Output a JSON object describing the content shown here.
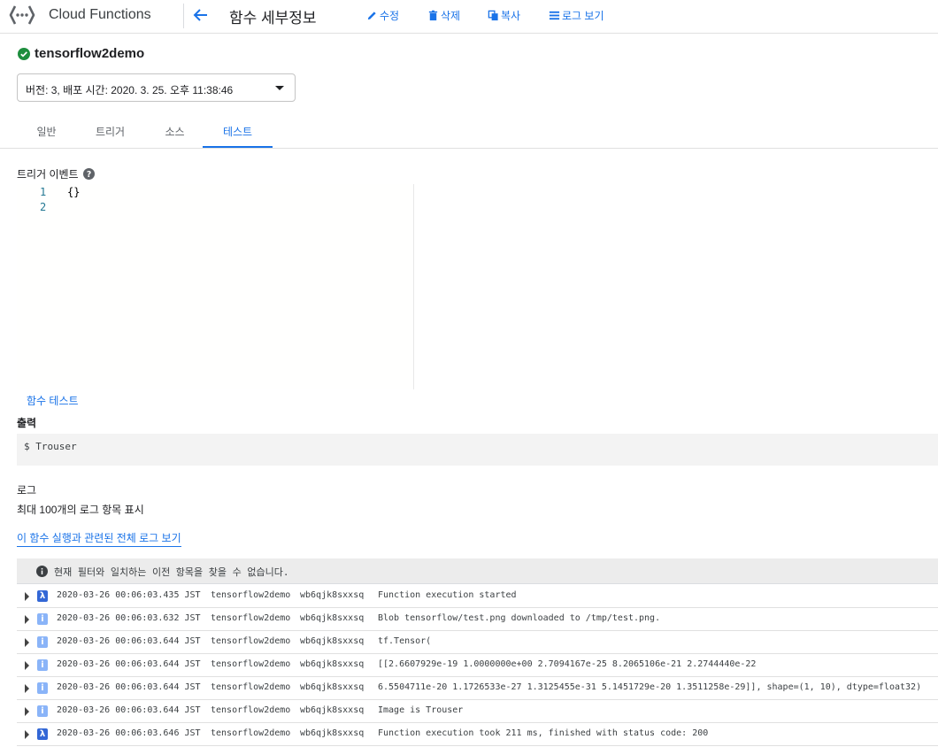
{
  "header": {
    "product_name": "Cloud Functions",
    "page_title": "함수 세부정보",
    "actions": {
      "edit": "수정",
      "delete": "삭제",
      "copy": "복사",
      "view_logs": "로그 보기"
    }
  },
  "function": {
    "name": "tensorflow2demo",
    "status_icon": "check-circle-icon",
    "status_color": "#1e8e3e",
    "version_select": "버전: 3, 배포 시간: 2020. 3. 25. 오후 11:38:46"
  },
  "tabs": [
    {
      "label": "일반",
      "active": false
    },
    {
      "label": "트리거",
      "active": false
    },
    {
      "label": "소스",
      "active": false
    },
    {
      "label": "테스트",
      "active": true
    }
  ],
  "trigger_event": {
    "label": "트리거 이벤트",
    "editor": {
      "line_numbers": [
        "1",
        "2"
      ],
      "lines": [
        "{}",
        ""
      ]
    }
  },
  "test_button": "함수 테스트",
  "output": {
    "label": "출력",
    "text": "$ Trouser"
  },
  "logs": {
    "label": "로그",
    "subtitle": "최대 100개의 로그 항목 표시",
    "view_all_link": "이 함수 실행과 관련된 전체 로그 보기",
    "notice": "현재 필터와 일치하는 이전 항목을 찾을 수 없습니다.",
    "entries": [
      {
        "severity": "debug",
        "icon": "λ",
        "time": "2020-03-26 00:06:03.435 JST",
        "function": "tensorflow2demo",
        "execution_id": "wb6qjk8sxxsq",
        "message": "Function execution started"
      },
      {
        "severity": "info",
        "icon": "i",
        "time": "2020-03-26 00:06:03.632 JST",
        "function": "tensorflow2demo",
        "execution_id": "wb6qjk8sxxsq",
        "message": "Blob tensorflow/test.png downloaded to /tmp/test.png."
      },
      {
        "severity": "info",
        "icon": "i",
        "time": "2020-03-26 00:06:03.644 JST",
        "function": "tensorflow2demo",
        "execution_id": "wb6qjk8sxxsq",
        "message": "tf.Tensor("
      },
      {
        "severity": "info",
        "icon": "i",
        "time": "2020-03-26 00:06:03.644 JST",
        "function": "tensorflow2demo",
        "execution_id": "wb6qjk8sxxsq",
        "message": "[[2.6607929e-19 1.0000000e+00 2.7094167e-25 8.2065106e-21 2.2744440e-22"
      },
      {
        "severity": "info",
        "icon": "i",
        "time": "2020-03-26 00:06:03.644 JST",
        "function": "tensorflow2demo",
        "execution_id": "wb6qjk8sxxsq",
        "message": "6.5504711e-20 1.1726533e-27 1.3125455e-31 5.1451729e-20 1.3511258e-29]], shape=(1, 10), dtype=float32)"
      },
      {
        "severity": "info",
        "icon": "i",
        "time": "2020-03-26 00:06:03.644 JST",
        "function": "tensorflow2demo",
        "execution_id": "wb6qjk8sxxsq",
        "message": "Image is Trouser"
      },
      {
        "severity": "debug",
        "icon": "λ",
        "time": "2020-03-26 00:06:03.646 JST",
        "function": "tensorflow2demo",
        "execution_id": "wb6qjk8sxxsq",
        "message": "Function execution took 211 ms, finished with status code: 200"
      }
    ]
  }
}
